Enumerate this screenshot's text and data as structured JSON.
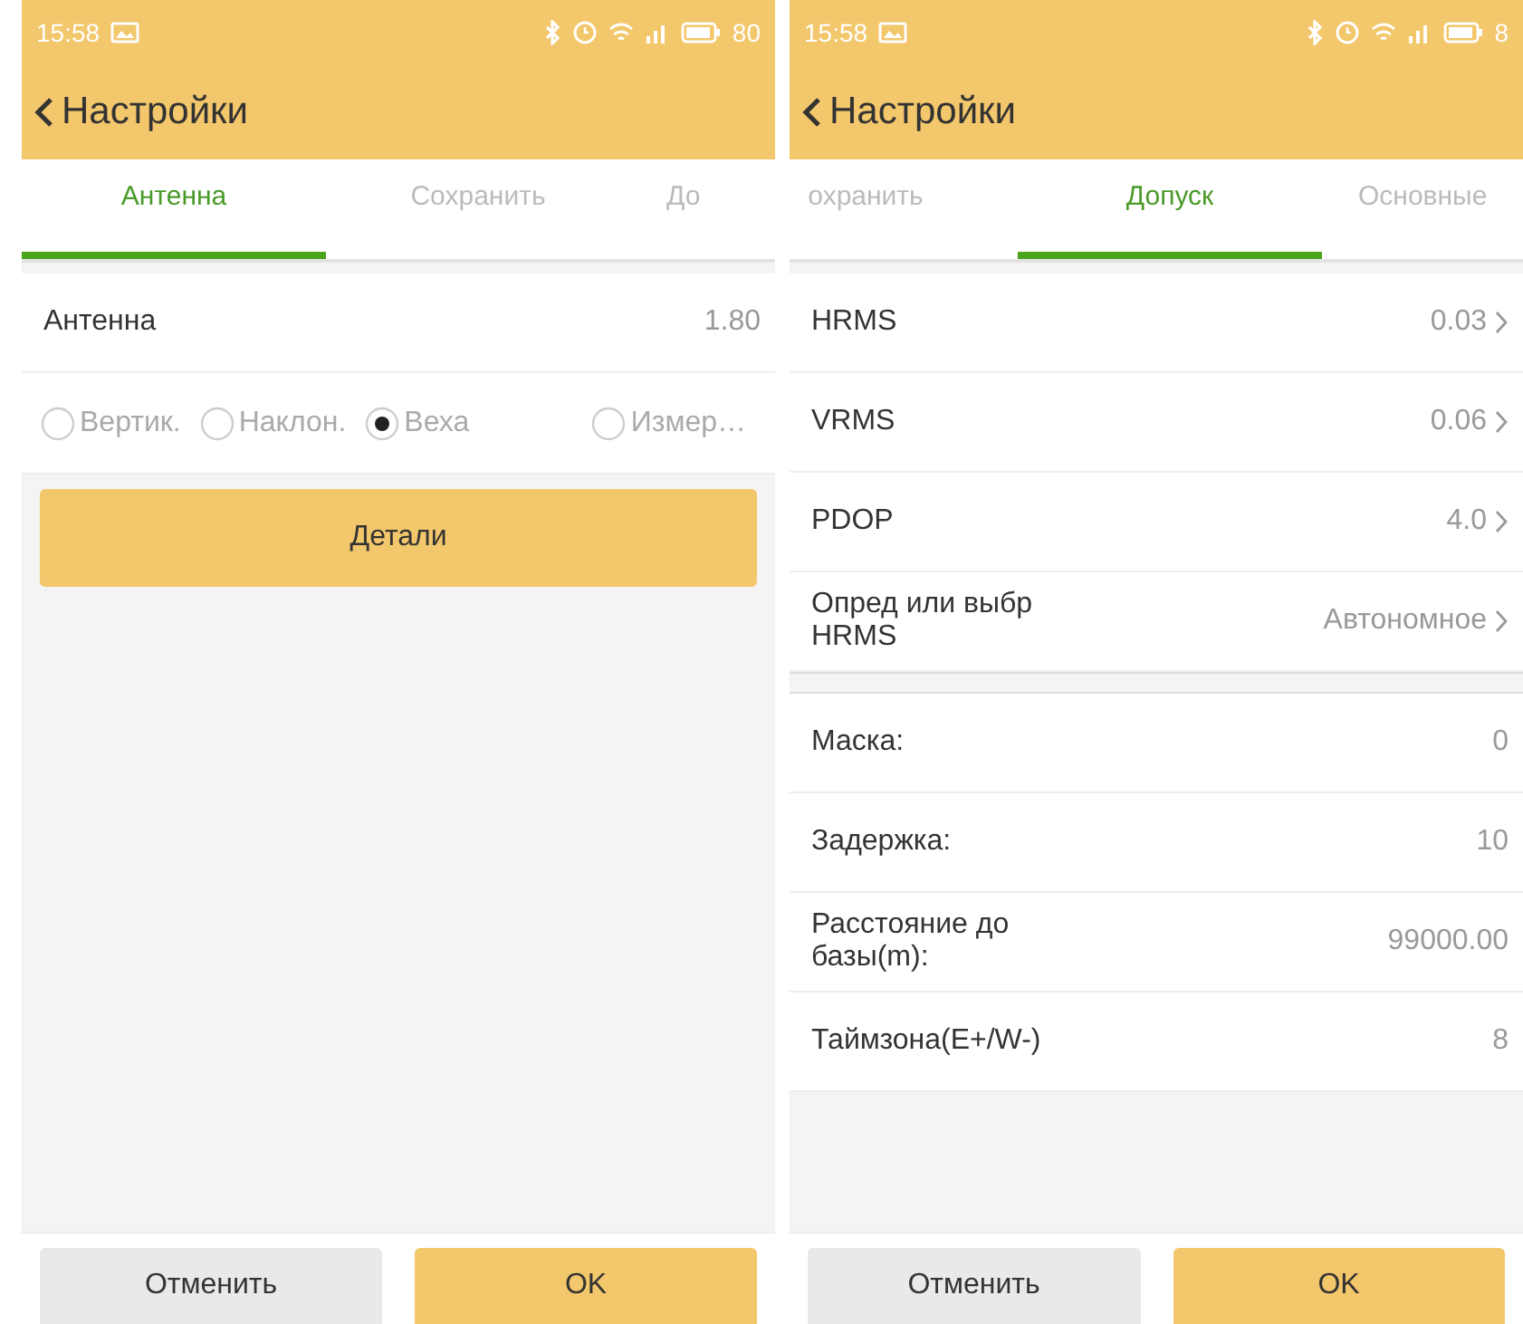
{
  "screens": [
    {
      "status_bar": {
        "time": "15:58",
        "battery": "80"
      },
      "header": {
        "back_label": "Настройки"
      },
      "tabs": [
        {
          "label": "Антенна",
          "selected": true
        },
        {
          "label": "Сохранить",
          "selected": false
        },
        {
          "label": "До",
          "selected": false
        }
      ],
      "content": [
        {
          "kind": "row",
          "label": "Антенна",
          "value": "1.80",
          "chevron": false
        },
        {
          "kind": "radios",
          "options": [
            {
              "label": "Вертик.",
              "selected": false
            },
            {
              "label": "Наклон.",
              "selected": false
            },
            {
              "label": "Веха",
              "selected": true
            },
            {
              "label": "Измер…",
              "selected": false
            }
          ]
        },
        {
          "kind": "button",
          "label": "Детали"
        }
      ],
      "footer": {
        "cancel": "Отменить",
        "ok": "OK"
      }
    },
    {
      "status_bar": {
        "time": "15:58",
        "battery": "8"
      },
      "header": {
        "back_label": "Настройки"
      },
      "tabs": [
        {
          "label": "охранить",
          "selected": false
        },
        {
          "label": "Допуск",
          "selected": true
        },
        {
          "label": "Основные",
          "selected": false
        }
      ],
      "content": [
        {
          "kind": "row",
          "label": "HRMS",
          "value": "0.03",
          "chevron": true
        },
        {
          "kind": "row",
          "label": "VRMS",
          "value": "0.06",
          "chevron": true
        },
        {
          "kind": "row",
          "label": "PDOP",
          "value": "4.0",
          "chevron": true
        },
        {
          "kind": "row",
          "label": "Опред или выбр HRMS",
          "value": "Автономное",
          "chevron": true
        },
        {
          "kind": "gap"
        },
        {
          "kind": "row",
          "label": "Маска:",
          "value": "0",
          "chevron": false
        },
        {
          "kind": "row",
          "label": "Задержка:",
          "value": "10",
          "chevron": false
        },
        {
          "kind": "row",
          "label": "Расстояние до базы(m):",
          "value": "99000.00",
          "chevron": false
        },
        {
          "kind": "row",
          "label": "Таймзона(E+/W-)",
          "value": "8",
          "chevron": false
        }
      ],
      "footer": {
        "cancel": "Отменить",
        "ok": "OK"
      }
    }
  ]
}
